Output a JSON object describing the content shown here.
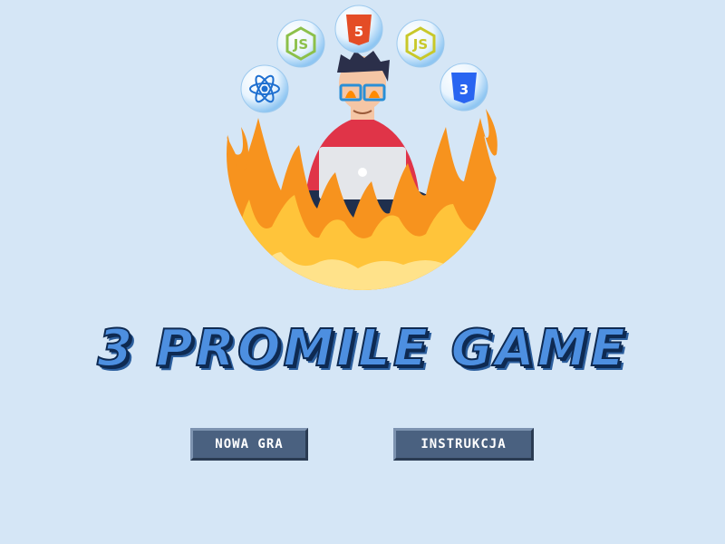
{
  "title": "3 PROMILE GAME",
  "menu": {
    "new_game_label": "NOWA GRA",
    "instructions_label": "INSTRUKCJA"
  },
  "icons": [
    "react-icon",
    "nodejs-icon",
    "html5-icon",
    "javascript-icon",
    "css3-icon"
  ],
  "colors": {
    "background": "#d5e6f6",
    "title_fill": "#4d8fe0",
    "button_bg": "#4a6180",
    "flame": "#f7931e"
  }
}
